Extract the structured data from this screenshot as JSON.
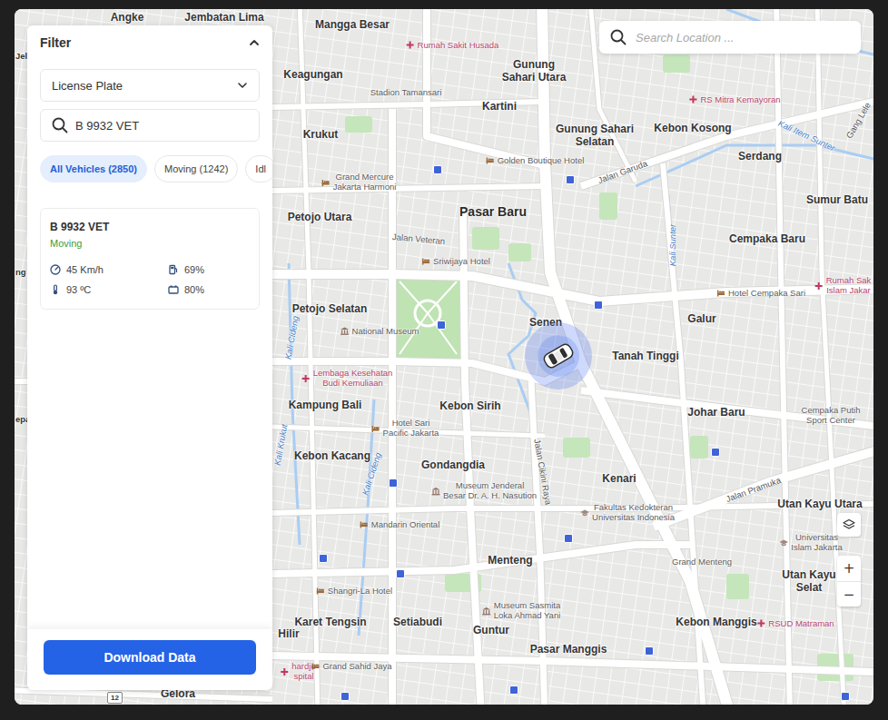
{
  "map": {
    "labels": [
      {
        "lines": [
          "Jembatan Lima"
        ],
        "kind": "place"
      },
      {
        "lines": [
          "Angke"
        ],
        "kind": "place"
      },
      {
        "lines": [
          "Mangga Besar"
        ],
        "kind": "place"
      },
      {
        "lines": [
          "Rumah Sakit Husada"
        ],
        "kind": "hospital"
      },
      {
        "lines": [
          "Gunung",
          "Sahari Utara"
        ],
        "kind": "place"
      },
      {
        "lines": [
          "Keagungan"
        ],
        "kind": "place"
      },
      {
        "lines": [
          "Stadion Tamansari"
        ],
        "kind": "poi"
      },
      {
        "lines": [
          "RS Mitra Kemayoran"
        ],
        "kind": "hospital"
      },
      {
        "lines": [
          "Kartini"
        ],
        "kind": "place"
      },
      {
        "lines": [
          "Gunung Sahari",
          "Selatan"
        ],
        "kind": "place"
      },
      {
        "lines": [
          "Kebon Kosong"
        ],
        "kind": "place"
      },
      {
        "lines": [
          "Krukut"
        ],
        "kind": "place"
      },
      {
        "lines": [
          "Kali Item Sunter"
        ],
        "kind": "water"
      },
      {
        "lines": [
          "Gang Lele"
        ],
        "kind": "street"
      },
      {
        "lines": [
          "Golden Boutique Hotel"
        ],
        "kind": "hotel"
      },
      {
        "lines": [
          "Jalan Garuda"
        ],
        "kind": "street"
      },
      {
        "lines": [
          "Serdang"
        ],
        "kind": "place"
      },
      {
        "lines": [
          "Grand Mercure",
          "Jakarta Harmoni"
        ],
        "kind": "hotel"
      },
      {
        "lines": [
          "Sumur Batu"
        ],
        "kind": "place"
      },
      {
        "lines": [
          "Pasar Baru"
        ],
        "kind": "major"
      },
      {
        "lines": [
          "Petojo Utara"
        ],
        "kind": "place"
      },
      {
        "lines": [
          "Jalan Veteran"
        ],
        "kind": "street"
      },
      {
        "lines": [
          "Sriwijaya Hotel"
        ],
        "kind": "hotel"
      },
      {
        "lines": [
          "Kali Sunter"
        ],
        "kind": "water"
      },
      {
        "lines": [
          "Cempaka Baru"
        ],
        "kind": "place"
      },
      {
        "lines": [
          "Rumah Sak",
          "Islam Jakar"
        ],
        "kind": "hospital"
      },
      {
        "lines": [
          "Hotel Cempaka Sari"
        ],
        "kind": "hotel"
      },
      {
        "lines": [
          "Petojo Selatan"
        ],
        "kind": "place"
      },
      {
        "lines": [
          "Senen"
        ],
        "kind": "place"
      },
      {
        "lines": [
          "Galur"
        ],
        "kind": "place"
      },
      {
        "lines": [
          "National Museum"
        ],
        "kind": "museum"
      },
      {
        "lines": [
          "Kali Cideng"
        ],
        "kind": "water"
      },
      {
        "lines": [
          "Tanah Tinggi"
        ],
        "kind": "place"
      },
      {
        "lines": [
          "Lembaga Kesehatan",
          "Budi Kemuliaan"
        ],
        "kind": "hospital"
      },
      {
        "lines": [
          "Kampung Bali"
        ],
        "kind": "place"
      },
      {
        "lines": [
          "Kebon Sirih"
        ],
        "kind": "place"
      },
      {
        "lines": [
          "Johar Baru"
        ],
        "kind": "place"
      },
      {
        "lines": [
          "Cempaka Putih",
          "Sport Center"
        ],
        "kind": "poi"
      },
      {
        "lines": [
          "Hotel Sari",
          "Pacific Jakarta"
        ],
        "kind": "hotel"
      },
      {
        "lines": [
          "Kali Krukut"
        ],
        "kind": "water"
      },
      {
        "lines": [
          "Kebon Kacang"
        ],
        "kind": "place"
      },
      {
        "lines": [
          "Kali Cideng"
        ],
        "kind": "water"
      },
      {
        "lines": [
          "Gondangdia"
        ],
        "kind": "place"
      },
      {
        "lines": [
          "Jalan Cikini Raya"
        ],
        "kind": "street"
      },
      {
        "lines": [
          "Kenari"
        ],
        "kind": "place"
      },
      {
        "lines": [
          "Jalan Pramuka"
        ],
        "kind": "street"
      },
      {
        "lines": [
          "Museum Jenderal",
          "Besar Dr. A. H. Nasution"
        ],
        "kind": "museum"
      },
      {
        "lines": [
          "Fakultas Kedokteran",
          "Universitas Indonesia"
        ],
        "kind": "school"
      },
      {
        "lines": [
          "Utan Kayu Utara"
        ],
        "kind": "place"
      },
      {
        "lines": [
          "Universitas",
          "Islam Jakarta"
        ],
        "kind": "school"
      },
      {
        "lines": [
          "Mandarin Oriental"
        ],
        "kind": "hotel"
      },
      {
        "lines": [
          "Menteng"
        ],
        "kind": "place"
      },
      {
        "lines": [
          "Grand Menteng"
        ],
        "kind": "poi"
      },
      {
        "lines": [
          "Utan Kayu",
          "Selat"
        ],
        "kind": "place"
      },
      {
        "lines": [
          "Shangri-La Hotel"
        ],
        "kind": "hotel"
      },
      {
        "lines": [
          "Museum Sasmita",
          "Loka Ahmad Yani"
        ],
        "kind": "museum"
      },
      {
        "lines": [
          "Karet Tengsin"
        ],
        "kind": "place"
      },
      {
        "lines": [
          "Setiabudi"
        ],
        "kind": "place"
      },
      {
        "lines": [
          "Kebon Manggis"
        ],
        "kind": "place"
      },
      {
        "lines": [
          "RSUD Matraman"
        ],
        "kind": "hospital"
      },
      {
        "lines": [
          "Guntur"
        ],
        "kind": "place"
      },
      {
        "lines": [
          "Hilir"
        ],
        "kind": "place"
      },
      {
        "lines": [
          "Pasar Manggis"
        ],
        "kind": "place"
      },
      {
        "lines": [
          "hardjo",
          "spital"
        ],
        "kind": "hospital"
      },
      {
        "lines": [
          "Grand Sahid Jaya"
        ],
        "kind": "hotel"
      },
      {
        "lines": [
          "Gelora"
        ],
        "kind": "place"
      },
      {
        "lines": [
          "Jel"
        ],
        "kind": "fragment"
      },
      {
        "lines": [
          "ng"
        ],
        "kind": "fragment"
      },
      {
        "lines": [
          "epa"
        ],
        "kind": "fragment"
      }
    ],
    "route_shield": "12"
  },
  "search": {
    "placeholder": "Search Location ..."
  },
  "zoom": {
    "in": "+",
    "out": "−"
  },
  "filter": {
    "title": "Filter",
    "expanded": true,
    "field": "License Plate",
    "query": "B 9932 VET",
    "chips": [
      {
        "label": "All Vehicles (2850)",
        "selected": true
      },
      {
        "label": "Moving (1242)",
        "selected": false
      },
      {
        "label": "Idl",
        "selected": false
      }
    ]
  },
  "vehicles": [
    {
      "plate": "B 9932 VET",
      "status": "Moving",
      "speed": "45 Km/h",
      "fuel": "69%",
      "temperature": "93 ºC",
      "battery": "80%"
    }
  ],
  "buttons": [
    "Download Data"
  ]
}
